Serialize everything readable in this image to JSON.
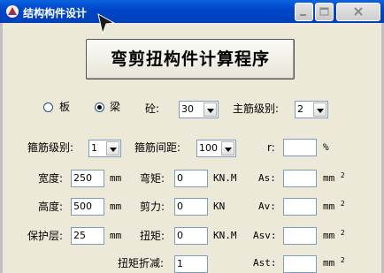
{
  "window": {
    "title": "结构构件设计"
  },
  "header": {
    "title": "弯剪扭构件计算程序"
  },
  "member_type": {
    "plate_label": "板",
    "beam_label": "梁",
    "selected": "beam"
  },
  "concrete": {
    "label": "砼:",
    "value": "30"
  },
  "main_grade": {
    "label": "主筋级别:",
    "value": "2"
  },
  "stirrup_grade": {
    "label": "箍筋级别:",
    "value": "1"
  },
  "stirrup_spacing": {
    "label": "箍筋间距:",
    "value": "100"
  },
  "ratio": {
    "label": "r:",
    "value": "",
    "unit": "%"
  },
  "width": {
    "label": "宽度:",
    "value": "250",
    "unit": "mm"
  },
  "moment": {
    "label": "弯矩:",
    "value": "0",
    "unit": "KN.M"
  },
  "as": {
    "label": "As:",
    "value": "",
    "unit": "mm",
    "sup": "2"
  },
  "height": {
    "label": "高度:",
    "value": "500",
    "unit": "mm"
  },
  "shear": {
    "label": "剪力:",
    "value": "0",
    "unit": "KN"
  },
  "av": {
    "label": "Av:",
    "value": "",
    "unit": "mm",
    "sup": "2"
  },
  "cover": {
    "label": "保护层:",
    "value": "25",
    "unit": "mm"
  },
  "torque": {
    "label": "扭矩:",
    "value": "0",
    "unit": "KN.M"
  },
  "asv": {
    "label": "Asv:",
    "value": "",
    "unit": "mm",
    "sup": "2"
  },
  "torque_reduction": {
    "label": "扭矩折减:",
    "value": "1"
  },
  "ast": {
    "label": "Ast:",
    "value": "",
    "unit": "mm",
    "sup": "2"
  }
}
